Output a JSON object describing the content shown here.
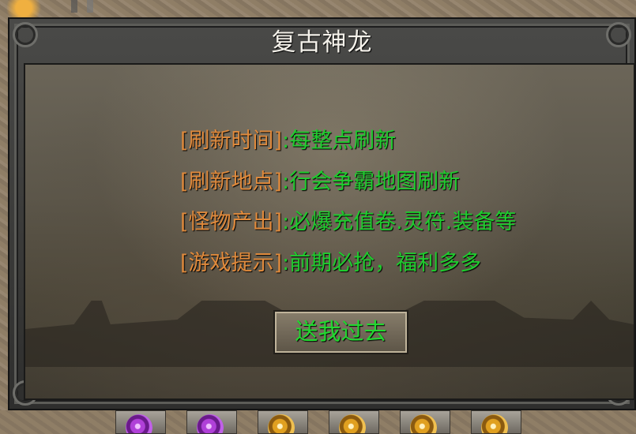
{
  "dialog": {
    "title": "复古神龙",
    "lines": [
      {
        "label": "[刷新时间]",
        "value": ":每整点刷新"
      },
      {
        "label": "[刷新地点]",
        "value": ":行会争霸地图刷新"
      },
      {
        "label": "[怪物产出]",
        "value": ":必爆充值卷.灵符.装备等"
      },
      {
        "label": "[游戏提示]",
        "value": ":前期必抢，福利多多"
      }
    ],
    "button_label": "送我过去"
  },
  "item_bar": {
    "slots": [
      {
        "icon": "purple-orb-icon"
      },
      {
        "icon": "purple-orb-icon"
      },
      {
        "icon": "gold-orb-icon"
      },
      {
        "icon": "gold-orb-icon"
      },
      {
        "icon": "gold-orb-icon"
      },
      {
        "icon": "gold-orb-icon"
      }
    ]
  },
  "colors": {
    "label": "#e08a3c",
    "value": "#1fcc2e",
    "title": "#f4f1ea"
  }
}
